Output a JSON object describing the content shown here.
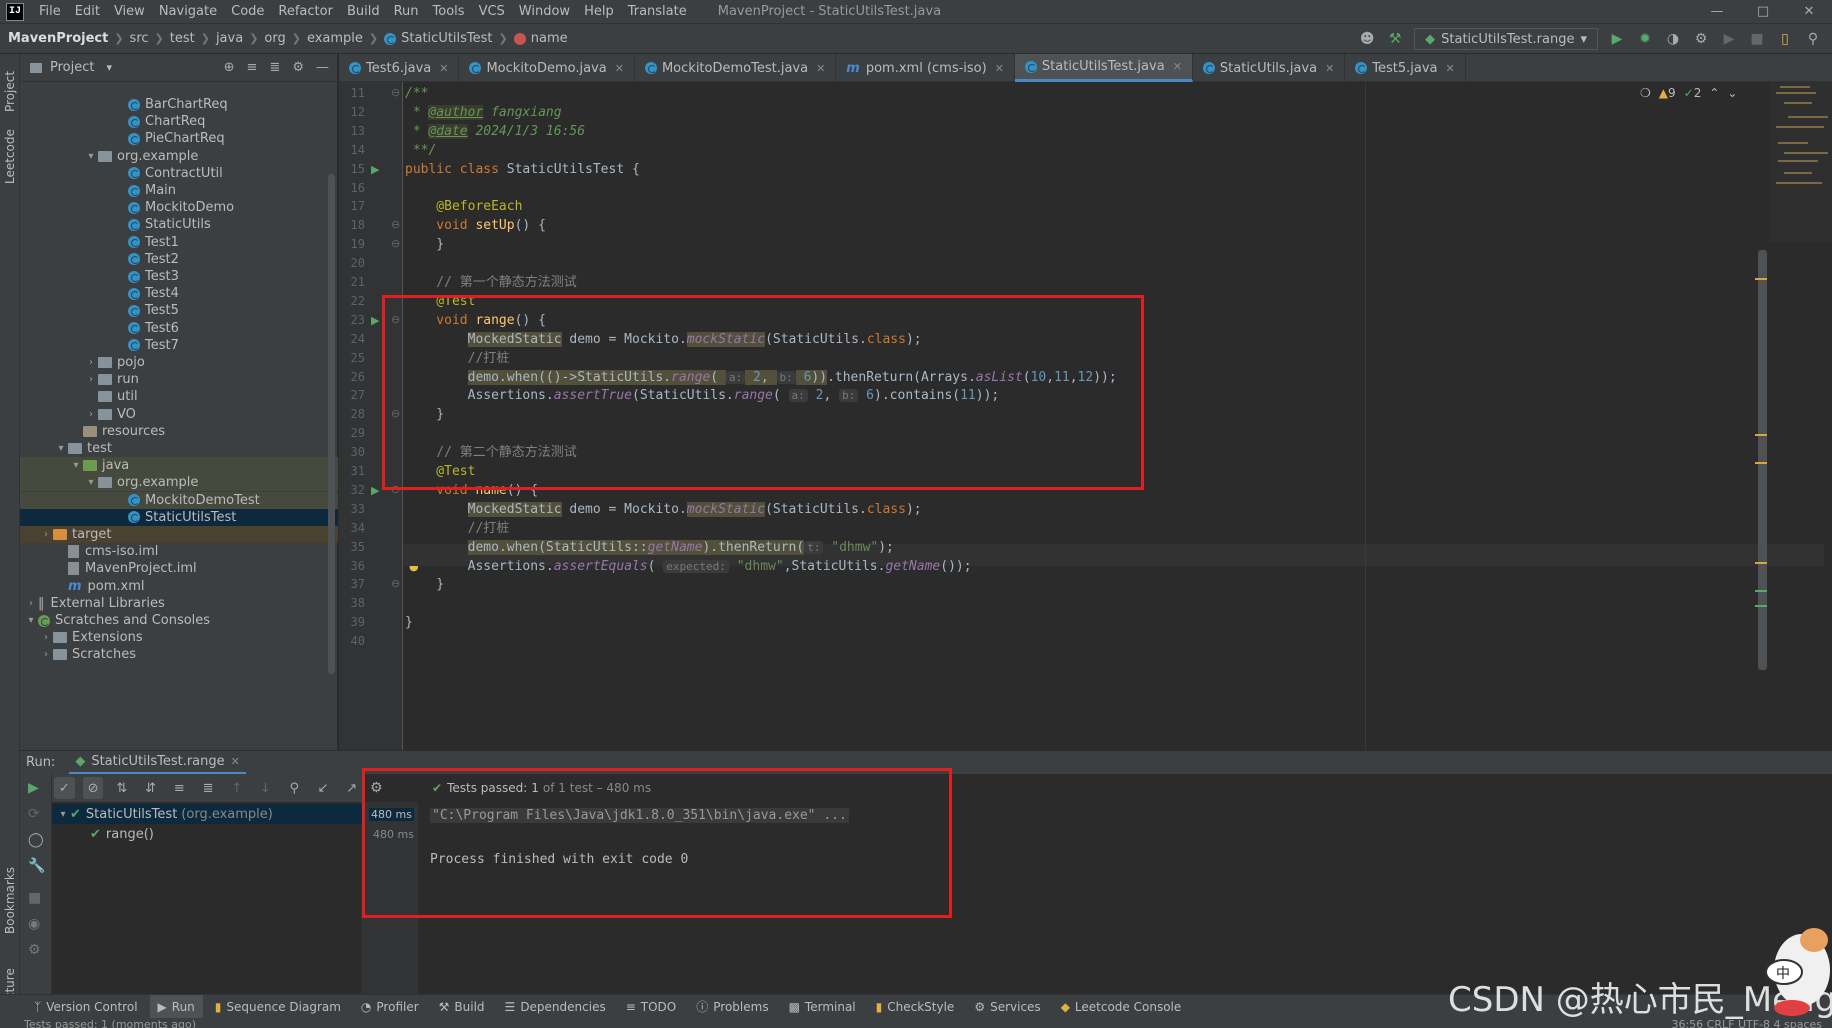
{
  "menubar": {
    "logo": "IJ",
    "items": [
      "File",
      "Edit",
      "View",
      "Navigate",
      "Code",
      "Refactor",
      "Build",
      "Run",
      "Tools",
      "VCS",
      "Window",
      "Help",
      "Translate"
    ],
    "title": "MavenProject - StaticUtilsTest.java"
  },
  "navbar": {
    "project": "MavenProject",
    "crumbs": [
      "src",
      "test",
      "java",
      "org",
      "example"
    ],
    "class": "StaticUtilsTest",
    "method": "name",
    "run_config": "StaticUtilsTest.range"
  },
  "project_panel": {
    "title": "Project",
    "tree": [
      {
        "label": "BarChartReq",
        "type": "class",
        "indent": 6
      },
      {
        "label": "ChartReq",
        "type": "class",
        "indent": 6
      },
      {
        "label": "PieChartReq",
        "type": "class",
        "indent": 6
      },
      {
        "label": "org.example",
        "type": "package",
        "indent": 4,
        "arrow": "v"
      },
      {
        "label": "ContractUtil",
        "type": "class",
        "indent": 6
      },
      {
        "label": "Main",
        "type": "class",
        "indent": 6
      },
      {
        "label": "MockitoDemo",
        "type": "class",
        "indent": 6
      },
      {
        "label": "StaticUtils",
        "type": "class",
        "indent": 6
      },
      {
        "label": "Test1",
        "type": "class",
        "indent": 6
      },
      {
        "label": "Test2",
        "type": "class",
        "indent": 6
      },
      {
        "label": "Test3",
        "type": "class",
        "indent": 6
      },
      {
        "label": "Test4",
        "type": "class",
        "indent": 6
      },
      {
        "label": "Test5",
        "type": "class",
        "indent": 6
      },
      {
        "label": "Test6",
        "type": "class",
        "indent": 6
      },
      {
        "label": "Test7",
        "type": "class",
        "indent": 6
      },
      {
        "label": "pojo",
        "type": "package",
        "indent": 4,
        "arrow": ">"
      },
      {
        "label": "run",
        "type": "package",
        "indent": 4,
        "arrow": ">"
      },
      {
        "label": "util",
        "type": "package",
        "indent": 4,
        "arrow": ""
      },
      {
        "label": "VO",
        "type": "package",
        "indent": 4,
        "arrow": ">"
      },
      {
        "label": "resources",
        "type": "resfolder",
        "indent": 3,
        "arrow": ""
      },
      {
        "label": "test",
        "type": "folder",
        "indent": 2,
        "arrow": "v"
      },
      {
        "label": "java",
        "type": "gfolder",
        "indent": 3,
        "arrow": "v",
        "hl": true
      },
      {
        "label": "org.example",
        "type": "package",
        "indent": 4,
        "arrow": "v",
        "hl": true
      },
      {
        "label": "MockitoDemoTest",
        "type": "class",
        "indent": 6,
        "hl": true
      },
      {
        "label": "StaticUtilsTest",
        "type": "class",
        "indent": 6,
        "sel": true
      },
      {
        "label": "target",
        "type": "ofolder",
        "indent": 1,
        "arrow": ">",
        "tgt": true
      },
      {
        "label": "cms-iso.iml",
        "type": "file",
        "indent": 2
      },
      {
        "label": "MavenProject.iml",
        "type": "file",
        "indent": 2
      },
      {
        "label": "pom.xml",
        "type": "mfile",
        "indent": 2
      },
      {
        "label": "External Libraries",
        "type": "lib",
        "indent": 0,
        "arrow": ">"
      },
      {
        "label": "Scratches and Consoles",
        "type": "scratch",
        "indent": 0,
        "arrow": "v"
      },
      {
        "label": "Extensions",
        "type": "folder",
        "indent": 1,
        "arrow": ">"
      },
      {
        "label": "Scratches",
        "type": "folder",
        "indent": 1,
        "arrow": ">"
      }
    ]
  },
  "tabs": [
    {
      "label": "Test6.java",
      "icon": "class"
    },
    {
      "label": "MockitoDemo.java",
      "icon": "class"
    },
    {
      "label": "MockitoDemoTest.java",
      "icon": "class"
    },
    {
      "label": "pom.xml (cms-iso)",
      "icon": "maven"
    },
    {
      "label": "StaticUtilsTest.java",
      "icon": "class",
      "active": true
    },
    {
      "label": "StaticUtils.java",
      "icon": "class"
    },
    {
      "label": "Test5.java",
      "icon": "class"
    }
  ],
  "inspections": {
    "warnings": "9",
    "weak": "2"
  },
  "code": {
    "line_numbers": [
      "11",
      "12",
      "13",
      "14",
      "15",
      "16",
      "17",
      "18",
      "19",
      "20",
      "21",
      "22",
      "23",
      "24",
      "25",
      "26",
      "27",
      "28",
      "29",
      "30",
      "31",
      "32",
      "33",
      "34",
      "35",
      "36",
      "37",
      "38",
      "39",
      "40"
    ],
    "l11": "/**",
    "l12a": " * ",
    "l12tag": "@author",
    "l12b": " fangxiang",
    "l13a": " * ",
    "l13tag": "@date",
    "l13b": " 2024/1/3 16:56",
    "l14": " **/",
    "l15kw": "public class",
    "l15b": " StaticUtilsTest {",
    "l17": "    @BeforeEach",
    "l18kw": "    void",
    "l18fn": " setUp",
    "l18b": "() {",
    "l19": "    }",
    "l21": "    // 第一个静态方法测试",
    "l22": "    @Test",
    "l23kw": "    void",
    "l23fn": " range",
    "l23b": "() {",
    "l24a": "MockedStatic",
    "l24b": " demo = Mockito.",
    "l24c": "mockStatic",
    "l24d": "(StaticUtils.",
    "l24e": "class",
    "l24f": ");",
    "l25": "        //打桩",
    "l26a": "demo.when(",
    "l26b": "()->StaticUtils.",
    "l26c": "range",
    "l26d": "( ",
    "l26h1": "a:",
    "l26n1": " 2",
    "l26e": ", ",
    "l26h2": "b:",
    "l26n2": " 6",
    "l26f": "))",
    "l26g": ".thenReturn(Arrays.",
    "l26i": "asList",
    "l26j": "(",
    "l26k": "10",
    "l26l": ",",
    "l26m": "11",
    "l26o": ",",
    "l26p": "12",
    "l26q": "));",
    "l27a": "        Assertions.",
    "l27b": "assertTrue",
    "l27c": "(StaticUtils.",
    "l27d": "range",
    "l27e": "( ",
    "l27h1": "a:",
    "l27n1": " 2",
    "l27f": ", ",
    "l27h2": "b:",
    "l27n2": " 6",
    "l27g": ").contains(",
    "l27k": "11",
    "l27l": "));",
    "l28": "    }",
    "l30": "    // 第二个静态方法测试",
    "l31": "    @Test",
    "l32kw": "    void",
    "l32fn": " name",
    "l32b": "() {",
    "l33a": "MockedStatic",
    "l33b": " demo = Mockito.",
    "l33c": "mockStatic",
    "l33d": "(StaticUtils.",
    "l33e": "class",
    "l33f": ");",
    "l34": "        //打桩",
    "l35a": "demo.when(StaticUtils::",
    "l35b": "getName",
    "l35c": ").thenReturn(",
    "l35h": "t:",
    "l35d": " \"dhmw\"",
    "l35e": ");",
    "l36a": "        Assertions.",
    "l36b": "assertEquals",
    "l36c": "( ",
    "l36h": "expected:",
    "l36d": " \"dhmw\"",
    "l36e": ",StaticUtils.",
    "l36f": "getName",
    "l36g": "());",
    "l37": "    }",
    "l39": "}"
  },
  "run_panel": {
    "label": "Run:",
    "tab": "StaticUtilsTest.range",
    "status_prefix": "Tests passed:",
    "status_count": "1",
    "status_suffix": "of 1 test – 480 ms",
    "tree": [
      {
        "label": "StaticUtilsTest",
        "pkg": "(org.example)",
        "time": "480 ms"
      },
      {
        "label": "range()",
        "time": "480 ms"
      }
    ],
    "console": [
      "\"C:\\Program Files\\Java\\jdk1.8.0_351\\bin\\java.exe\" ...",
      "Process finished with exit code 0"
    ]
  },
  "bottombar": [
    "Version Control",
    "Run",
    "Sequence Diagram",
    "Profiler",
    "Build",
    "Dependencies",
    "TODO",
    "Problems",
    "Terminal",
    "CheckStyle",
    "Services",
    "Leetcode Console"
  ],
  "statusbar": {
    "text": "Tests passed: 1 (moments ago)",
    "right": "36:56   CRLF   UTF-8   4 spaces"
  },
  "left_strip": [
    "Project",
    "Leetcode",
    "Bookmarks",
    "Structure"
  ],
  "watermark": "CSDN @热心市民_Meng",
  "mascot_char": "中"
}
